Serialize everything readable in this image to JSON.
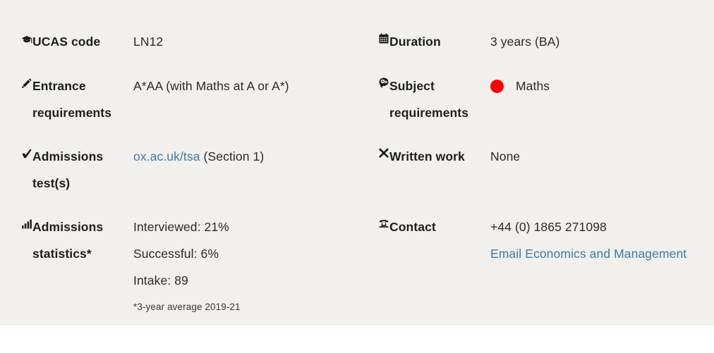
{
  "theme": {
    "panel_background": "#f1f0ec",
    "page_background": "#ffffff",
    "text_color": "#1e1e1e",
    "link_color": "#3f7aa8",
    "subject_dot_color": "#fa0000"
  },
  "left_column": {
    "rows": [
      {
        "icon": "graduation-cap-icon",
        "label": "UCAS code",
        "value": "LN12"
      },
      {
        "icon": "pencil-icon",
        "label": "Entrance requirements",
        "value": "A*AA (with Maths at A or A*)"
      },
      {
        "icon": "checkmark-icon",
        "label": "Admissions test(s)",
        "link_text": "ox.ac.uk/tsa",
        "value_suffix": " (Section 1)"
      },
      {
        "icon": "bar-chart-icon",
        "label": "Admissions statistics*",
        "stats": [
          "Interviewed: 21%",
          "Successful: 6%",
          "Intake: 89"
        ],
        "footnote": "*3-year average 2019-21"
      }
    ]
  },
  "right_column": {
    "rows": [
      {
        "icon": "calendar-icon",
        "label": "Duration",
        "value": "3 years (BA)"
      },
      {
        "icon": "head-gears-icon",
        "label": "Subject requirements",
        "subject": "Maths"
      },
      {
        "icon": "cross-x-icon",
        "label": "Written work",
        "value": "None"
      },
      {
        "icon": "telephone-icon",
        "label": "Contact",
        "phone": "+44 (0) 1865 271098",
        "email_link": "Email Economics and Management"
      }
    ]
  }
}
